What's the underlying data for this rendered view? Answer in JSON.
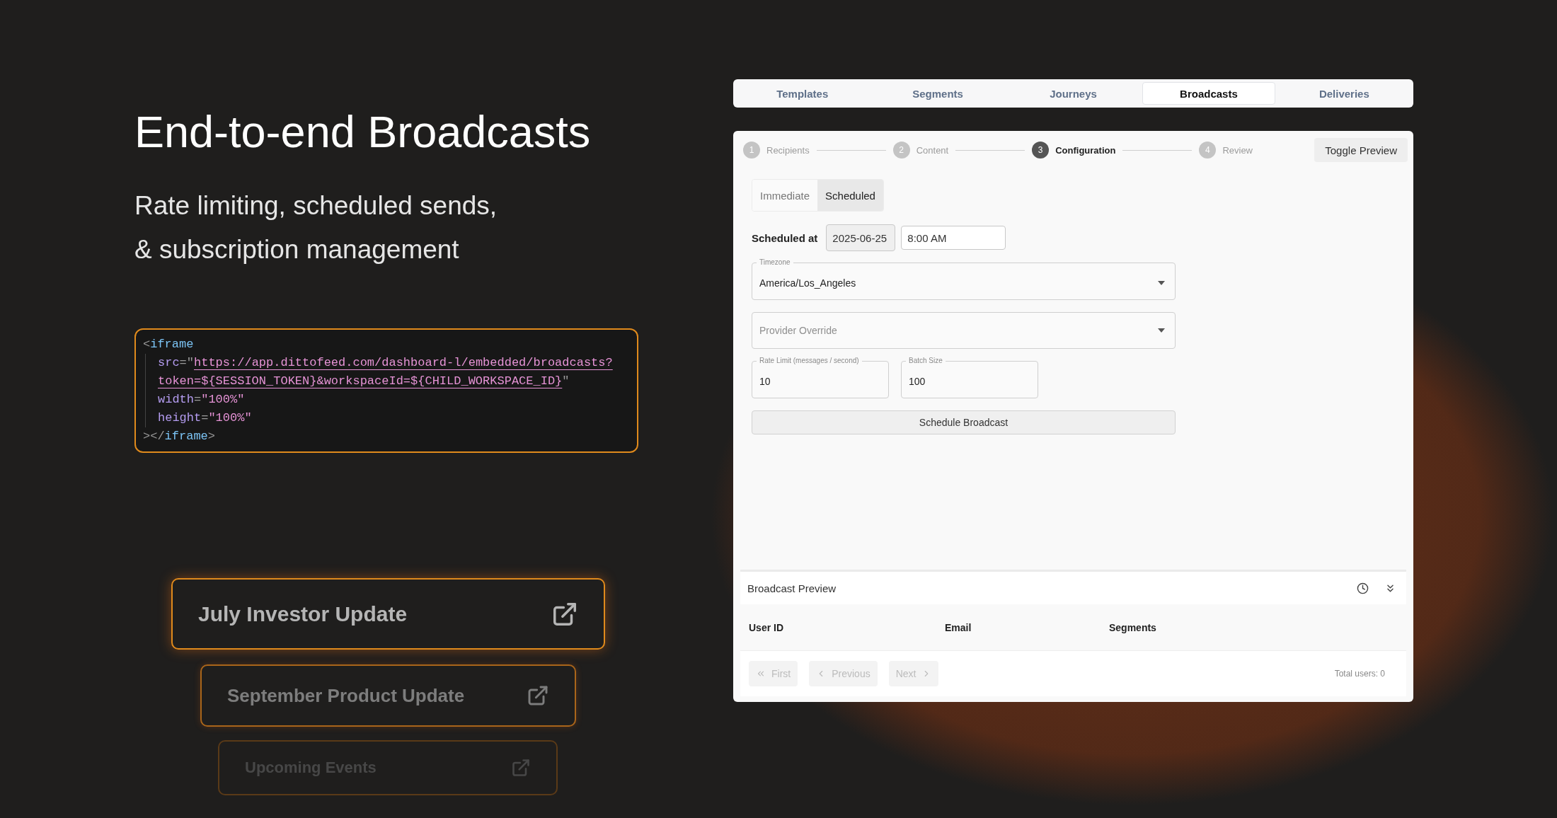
{
  "hero": {
    "title": "End-to-end Broadcasts",
    "subtitle_lines": [
      "Rate limiting, scheduled sends,",
      "& subscription management"
    ]
  },
  "code_lines": [
    {
      "indent": false,
      "tokens": [
        {
          "kind": "punct",
          "text": "<"
        },
        {
          "kind": "tag",
          "text": "iframe"
        }
      ]
    },
    {
      "indent": true,
      "tokens": [
        {
          "kind": "attr",
          "text": "src"
        },
        {
          "kind": "punct",
          "text": "=\""
        },
        {
          "kind": "link",
          "text": "https://app.dittofeed.com/dashboard-l/embedded/broadcasts?"
        }
      ]
    },
    {
      "indent": true,
      "tokens": [
        {
          "kind": "link",
          "text": "token=${SESSION_TOKEN}&workspaceId=${CHILD_WORKSPACE_ID}"
        },
        {
          "kind": "punct",
          "text": "\""
        }
      ]
    },
    {
      "indent": true,
      "tokens": [
        {
          "kind": "attr",
          "text": "width"
        },
        {
          "kind": "punct",
          "text": "="
        },
        {
          "kind": "string",
          "text": "\"100%\""
        }
      ]
    },
    {
      "indent": true,
      "tokens": [
        {
          "kind": "attr",
          "text": "height"
        },
        {
          "kind": "punct",
          "text": "="
        },
        {
          "kind": "string",
          "text": "\"100%\""
        }
      ]
    },
    {
      "indent": false,
      "tokens": [
        {
          "kind": "punct",
          "text": "></"
        },
        {
          "kind": "tag",
          "text": "iframe"
        },
        {
          "kind": "punct",
          "text": ">"
        }
      ]
    }
  ],
  "broadcast_cards": [
    {
      "kind": "primary",
      "title": "July Investor Update"
    },
    {
      "kind": "secondary",
      "title": "September Product Update"
    },
    {
      "kind": "tertiary",
      "title": "Upcoming Events"
    }
  ],
  "nav_tabs": [
    {
      "label": "Templates",
      "selected": false
    },
    {
      "label": "Segments",
      "selected": false
    },
    {
      "label": "Journeys",
      "selected": false
    },
    {
      "label": "Broadcasts",
      "selected": true
    },
    {
      "label": "Deliveries",
      "selected": false
    }
  ],
  "stepper": [
    {
      "number": "1",
      "label": "Recipients",
      "selected": false
    },
    {
      "number": "2",
      "label": "Content",
      "selected": false
    },
    {
      "number": "3",
      "label": "Configuration",
      "selected": true
    },
    {
      "number": "4",
      "label": "Review",
      "selected": false
    }
  ],
  "toggle_preview_button": "Toggle Preview",
  "mode_toggle": [
    {
      "label": "Immediate",
      "selected": false
    },
    {
      "label": "Scheduled",
      "selected": true
    }
  ],
  "scheduled_at": {
    "label": "Scheduled at",
    "date": "2025-06-25",
    "time": "8:00 AM"
  },
  "timezone_select": {
    "label": "Timezone",
    "value": "America/Los_Angeles"
  },
  "provider_select": {
    "placeholder": "Provider Override"
  },
  "rate_limit_field": {
    "label": "Rate Limit (messages / second)",
    "value": "10"
  },
  "batch_size_field": {
    "label": "Batch Size",
    "value": "100"
  },
  "schedule_button": "Schedule Broadcast",
  "preview": {
    "title": "Broadcast Preview",
    "columns": [
      "User ID",
      "Email",
      "Segments"
    ],
    "pagination": [
      {
        "kind": "first",
        "label": "First",
        "disabled": true
      },
      {
        "kind": "previous",
        "label": "Previous",
        "disabled": true
      },
      {
        "kind": "next",
        "label": "Next",
        "disabled": true
      }
    ],
    "total": "Total users: 0"
  }
}
